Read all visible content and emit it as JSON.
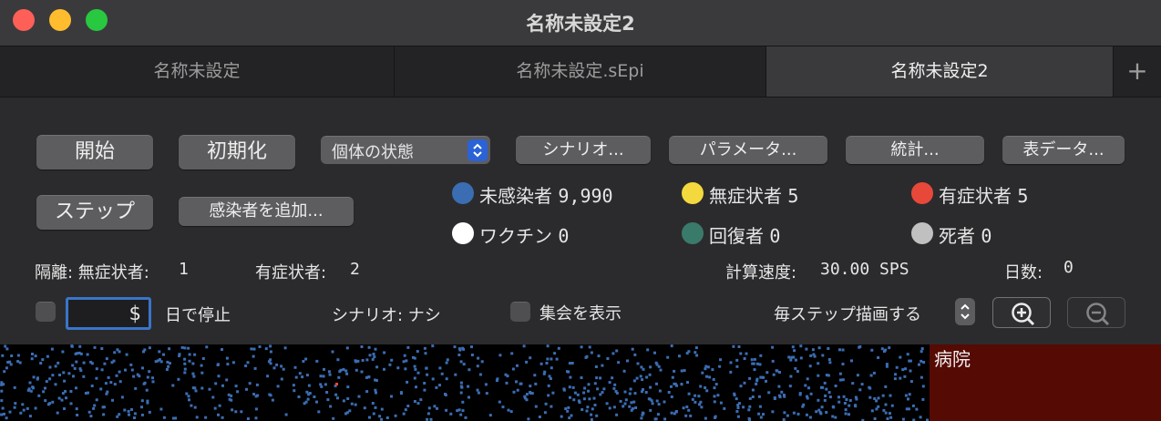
{
  "window": {
    "title": "名称未設定2"
  },
  "tabs": [
    {
      "label": "名称未設定",
      "active": false
    },
    {
      "label": "名称未設定.sEpi",
      "active": false
    },
    {
      "label": "名称未設定2",
      "active": true
    }
  ],
  "tab_add_label": "+",
  "buttons": {
    "start": "開始",
    "init": "初期化",
    "step": "ステップ",
    "add_infected": "感染者を追加...",
    "scenario": "シナリオ...",
    "parameters": "パラメータ...",
    "statistics": "統計...",
    "table_data": "表データ..."
  },
  "view_select": {
    "value": "個体の状態"
  },
  "legend": [
    {
      "label": "未感染者",
      "value": "9,990",
      "color": "#3b6db3"
    },
    {
      "label": "無症状者",
      "value": "5",
      "color": "#f4d93e"
    },
    {
      "label": "有症状者",
      "value": "5",
      "color": "#e8483a"
    },
    {
      "label": "ワクチン",
      "value": "0",
      "color": "#ffffff"
    },
    {
      "label": "回復者",
      "value": "0",
      "color": "#3a7a6a"
    },
    {
      "label": "死者",
      "value": "0",
      "color": "#c0c0c0"
    }
  ],
  "quarantine": {
    "label": "隔離: 無症状者:",
    "asymptomatic": "1",
    "symptomatic_label": "有症状者:",
    "symptomatic": "2"
  },
  "speed": {
    "label": "計算速度:",
    "value": "30.00 SPS"
  },
  "days": {
    "label": "日数:",
    "value": "0"
  },
  "stop": {
    "currency_glyph": "$",
    "label": "日で停止"
  },
  "scenario_status": "シナリオ: ナシ",
  "show_gathering": "集会を表示",
  "draw_mode": "毎ステップ描画する",
  "hospital_label": "病院",
  "icons": {
    "zoom_in": "zoom-in-icon",
    "zoom_out": "zoom-out-icon",
    "popup": "chevron-updown-icon",
    "stepper": "stepper-icon"
  }
}
